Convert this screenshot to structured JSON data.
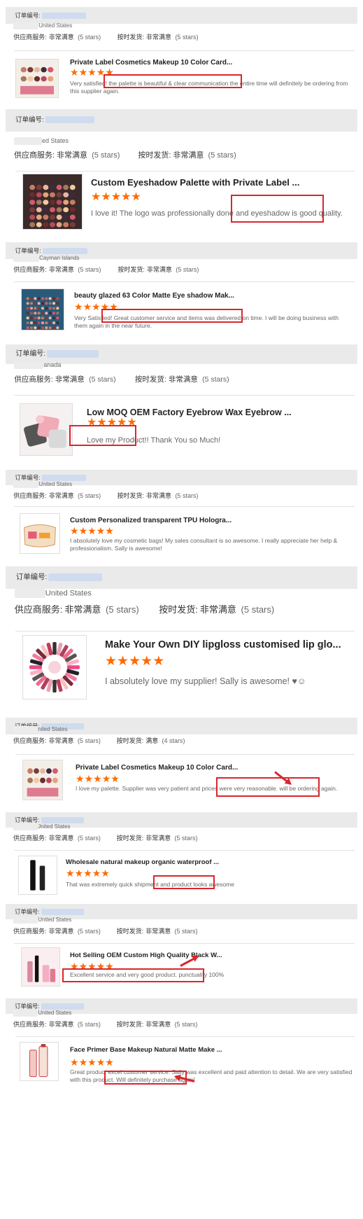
{
  "header_label": "订单编号:",
  "service_label": "供应商服务:",
  "service_value": "非常满意",
  "shipping_label": "按时发货:",
  "shipping_value": "非常满意",
  "rating_text": "(5 stars)",
  "reviews": [
    {
      "country": "United States",
      "title": "Private Label Cosmetics Makeup 10 Color Card...",
      "text": "Very satisfied! the palette is beautiful & clear communication the entire time will definitely be ordering from this supplier again.",
      "stars": 5
    },
    {
      "country": "ed States",
      "title": "Custom Eyeshadow Palette with Private Label ...",
      "text": "I love it! The logo was professionally done and eyeshadow is good quality.",
      "stars": 5
    },
    {
      "country": "Cayman Islands",
      "title": "beauty glazed 63 Color Matte Eye shadow Mak...",
      "text": "Very Satisfied! Great customer service and items was delivered on time. I will be doing business with them again in the near future.",
      "stars": 5
    },
    {
      "country": "anada",
      "title": "Low MOQ OEM Factory Eyebrow Wax Eyebrow ...",
      "text": "Love my Product!! Thank You so Much!",
      "stars": 5
    },
    {
      "country": "United States",
      "title": "Custom Personalized transparent TPU Hologra...",
      "text": "I absolutely love my cosmetic bags! My sales consultant is so awesome. I really appreciate her help & professionalism. Sally is awesome!",
      "stars": 5
    },
    {
      "country": "United States",
      "title": "Make Your Own DIY lipgloss customised lip glo...",
      "text": "I absolutely love my supplier! Sally is awesome! ♥☺",
      "stars": 5
    },
    {
      "country": "nited States",
      "title": "Private Label Cosmetics Makeup 10 Color Card...",
      "text": "I love my palette. Supplier was very patient and  prices were very reasonable. will be ordering again.",
      "stars": 5,
      "shipping_value": "满意",
      "shipping_rating": "(4 stars)"
    },
    {
      "country": "Jnited States",
      "title": "Wholesale natural makeup organic waterproof ...",
      "text": "That was extremely quick shipment and product looks awesome",
      "stars": 5
    },
    {
      "country": "United States",
      "title": "Hot Selling OEM Custom High Quality Black W...",
      "text": "Excellent service and very good product.  punctuality 100%",
      "stars": 5
    },
    {
      "country": "United States",
      "title": "Face Primer Base Makeup Natural Matte Make ...",
      "text": "Great product excel customer service. Sally was excellent and paid attention to detail. We are very satisfied with this product. Will definitely purchase again!",
      "stars": 5
    }
  ],
  "colors": {
    "star": "#ff6a00",
    "highlight_box": "#d9262c",
    "header_bg": "#eaeaea"
  }
}
